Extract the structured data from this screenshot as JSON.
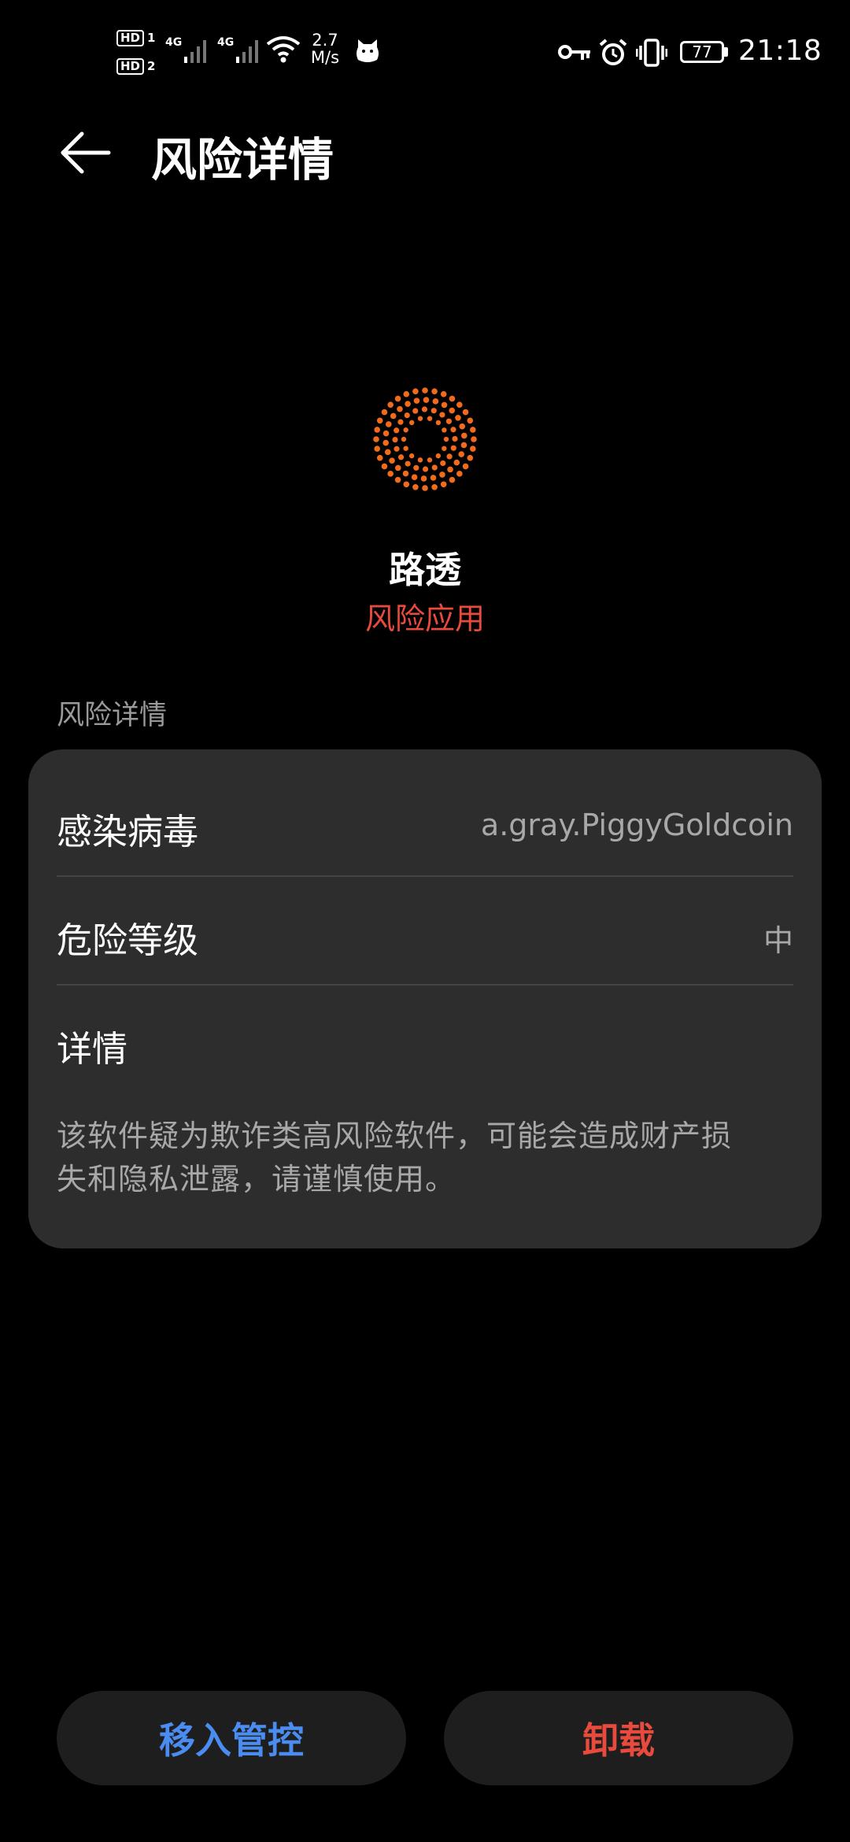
{
  "status_bar": {
    "sim1_badge": "HD",
    "sim1_num": "1",
    "sim2_badge": "HD",
    "sim2_num": "2",
    "net1": "4G",
    "net2": "4G",
    "speed_value": "2.7",
    "speed_unit": "M/s",
    "battery": "77",
    "time": "21:18"
  },
  "header": {
    "title": "风险详情"
  },
  "app": {
    "name": "路透",
    "status": "风险应用",
    "icon_color": "#f26a1b"
  },
  "section": {
    "label": "风险详情"
  },
  "details": {
    "virus_label": "感染病毒",
    "virus_value": "a.gray.PiggyGoldcoin",
    "level_label": "危险等级",
    "level_value": "中",
    "info_label": "详情",
    "description_line1": "该软件疑为欺诈类高风险软件，可能会造成财产损",
    "description_line2": "失和隐私泄露，请谨慎使用。"
  },
  "actions": {
    "manage_label": "移入管控",
    "manage_color": "#4a8cf0",
    "uninstall_label": "卸载",
    "uninstall_color": "#e84a3d"
  }
}
